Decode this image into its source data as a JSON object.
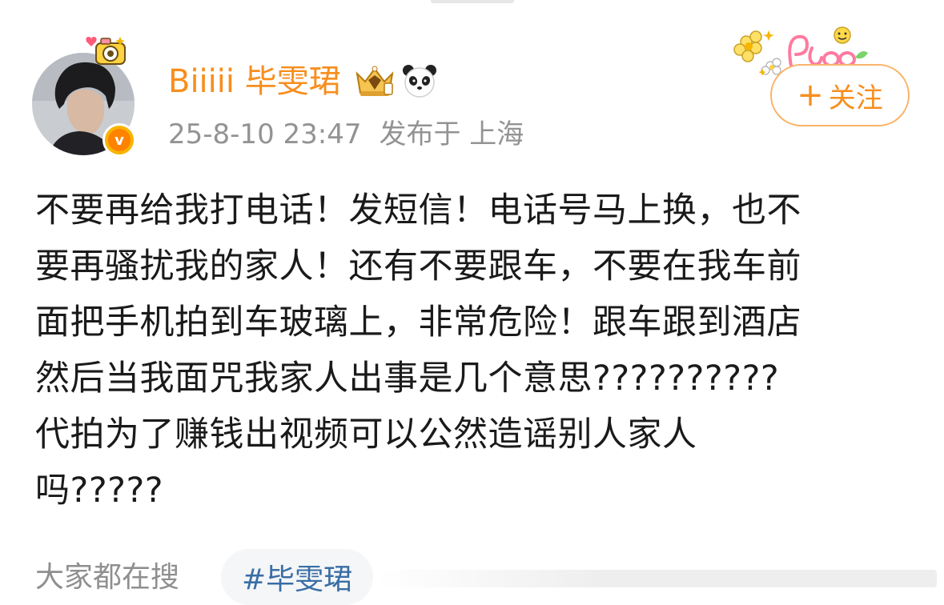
{
  "post": {
    "author": {
      "name": "Biiiii 毕雯珺",
      "verified": true,
      "avatar_icon": "avatar-photo",
      "pendant_icon": "camera-pendant-icon",
      "vip_icon": "vip-crown-icon",
      "panda_icon": "panda-emoji-icon",
      "verified_icon": "verified-v-icon",
      "name_color": "#f78e1e"
    },
    "meta": {
      "timestamp": "25-8-10 23:47",
      "location": "发布于 上海"
    },
    "follow_button": {
      "plus": "+",
      "label": "关注",
      "color": "#f78e1e"
    },
    "text": "不要再给我打电话！发短信！电话号马上换，也不\n要再骚扰我的家人！还有不要跟车，不要在我车前\n面把手机拍到车玻璃上，非常危险！跟车跟到酒店\n然后当我面咒我家人出事是几个意思??????????\n代拍为了赚钱出视频可以公然造谣别人家人\n吗?????",
    "card_decoration_icon": "flower-sticker-decoration"
  },
  "search": {
    "label": "大家都在搜",
    "hashtag": "#毕雯珺",
    "hashtag_color": "#3a6ea5"
  }
}
